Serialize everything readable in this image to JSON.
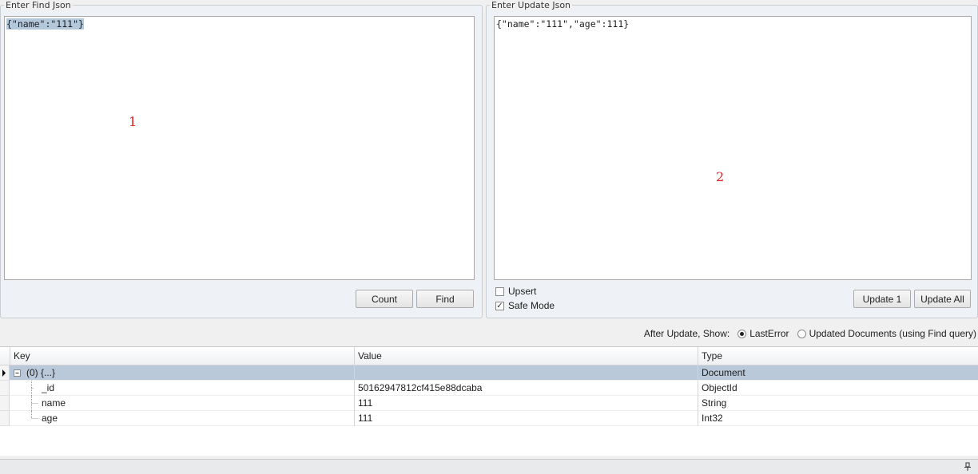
{
  "find": {
    "legend": "Enter Find Json",
    "json": "{\"name\":\"111\"}",
    "marker": "1",
    "count_label": "Count",
    "find_label": "Find"
  },
  "update": {
    "legend": "Enter Update Json",
    "json": "{\"name\":\"111\",\"age\":111}",
    "marker": "2",
    "upsert_label": "Upsert",
    "upsert_checked": false,
    "safe_mode_label": "Safe Mode",
    "safe_mode_checked": true,
    "update1_label": "Update 1",
    "update_all_label": "Update All"
  },
  "after_update": {
    "label": "After Update, Show:",
    "options": [
      {
        "label": "LastError",
        "selected": true
      },
      {
        "label": "Updated Documents (using Find query)",
        "selected": false
      }
    ]
  },
  "results": {
    "columns": [
      "Key",
      "Value",
      "Type"
    ],
    "rows": [
      {
        "key": "(0) {...}",
        "value": "",
        "type": "Document"
      },
      {
        "key": "_id",
        "value": "50162947812cf415e88dcaba",
        "type": "ObjectId"
      },
      {
        "key": "name",
        "value": "111",
        "type": "String"
      },
      {
        "key": "age",
        "value": "111",
        "type": "Int32"
      }
    ]
  },
  "status": {
    "pin_icon": "pin-icon"
  }
}
